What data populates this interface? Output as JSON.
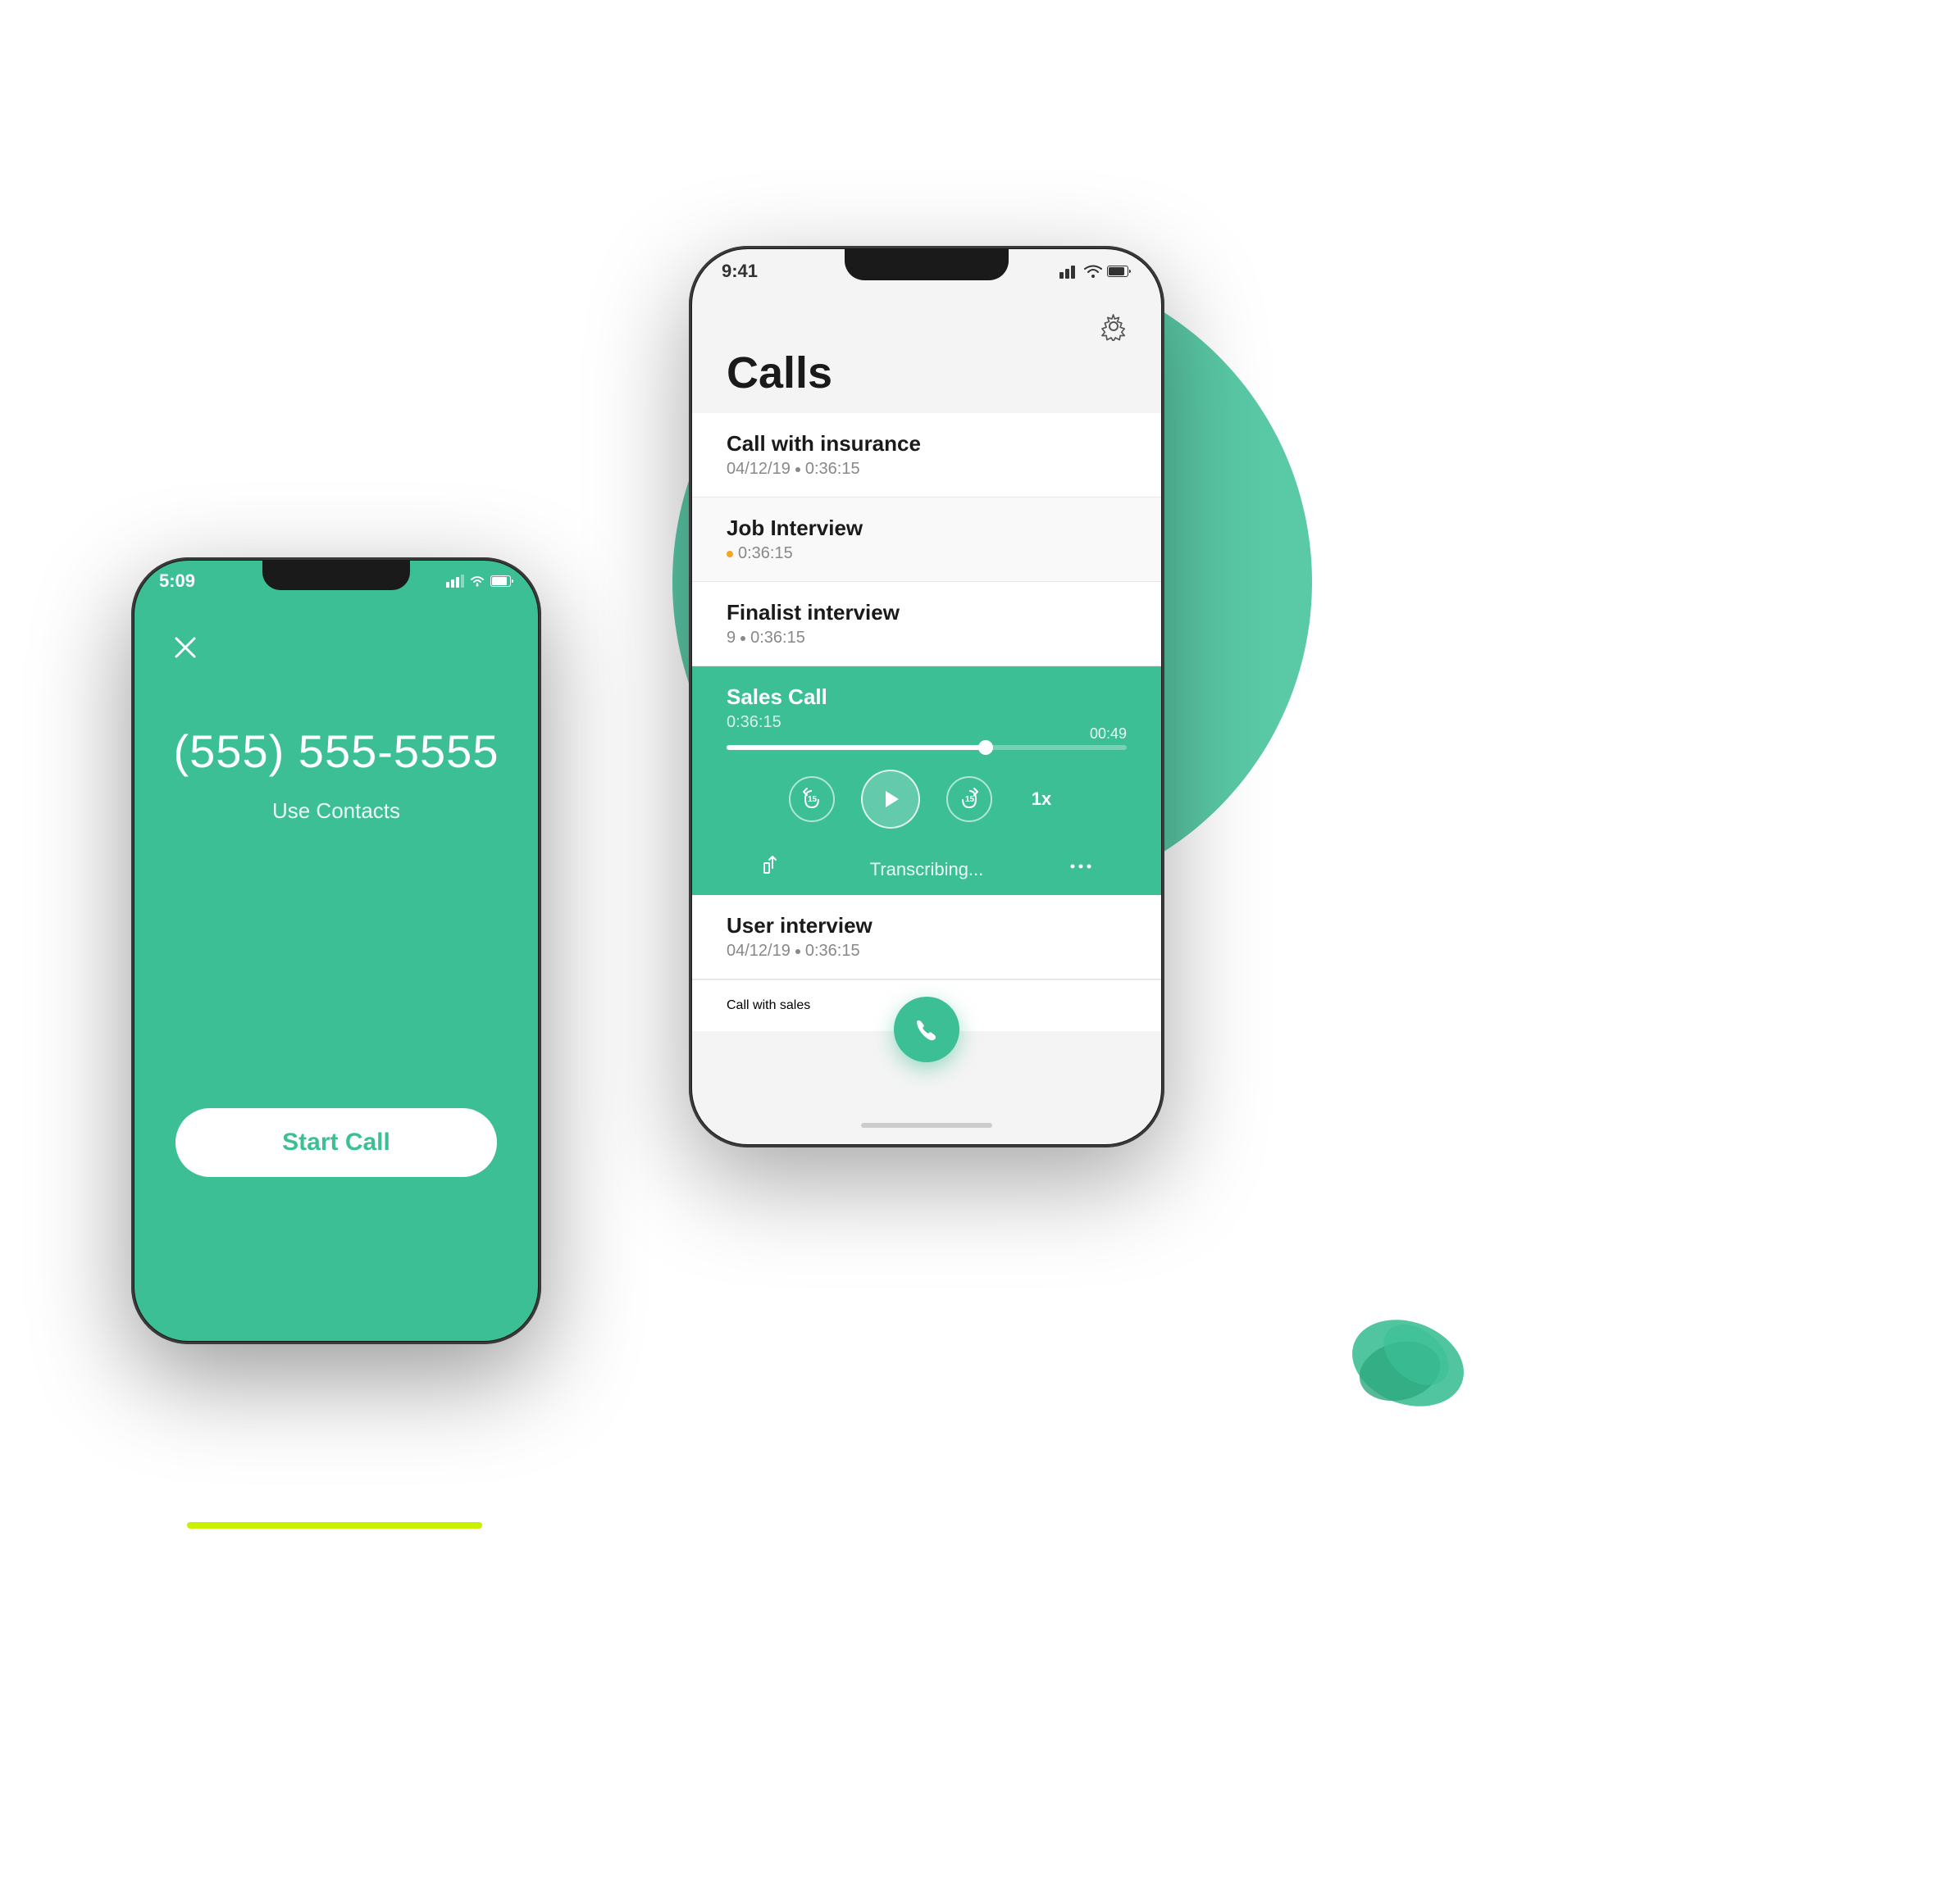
{
  "scene": {
    "background": "#ffffff"
  },
  "left_phone": {
    "time": "5:09",
    "phone_number": "(555) 555-5555",
    "use_contacts_label": "Use Contacts",
    "start_call_label": "Start Call",
    "screen_color": "#3dbf96"
  },
  "right_phone": {
    "time": "9:41",
    "title": "Calls",
    "gear_icon": "⚙",
    "fab_icon": "📞",
    "calls": [
      {
        "name": "Call with insurance",
        "date": "04/12/19",
        "duration": "0:36:15",
        "status": null
      },
      {
        "name": "Job Interview",
        "date": "",
        "duration": "0:36:15",
        "status": "processing"
      },
      {
        "name": "Finalist interview",
        "date": "9",
        "duration": "0:36:15",
        "status": null
      },
      {
        "name": "Sales Call",
        "date": "",
        "duration": "0:36:15",
        "status": "active",
        "progress": 65,
        "time_elapsed": "00:49"
      }
    ],
    "post_active_calls": [
      {
        "name": "User interview",
        "date": "04/12/19",
        "duration": "0:36:15"
      },
      {
        "name": "Call with sales",
        "date": "",
        "duration": ""
      }
    ],
    "transcribing_label": "Transcribing...",
    "playback": {
      "rewind_label": "15",
      "forward_label": "15",
      "speed_label": "1x"
    }
  },
  "icons": {
    "close_x": "✕",
    "share": "↑",
    "more": "•••",
    "play": "▶",
    "phone_call": "📞"
  },
  "colors": {
    "teal": "#3dbf96",
    "lime": "#c8f000",
    "dark": "#1a1a1a",
    "white": "#ffffff",
    "gray_text": "#888888",
    "orange_status": "#f5a623"
  }
}
